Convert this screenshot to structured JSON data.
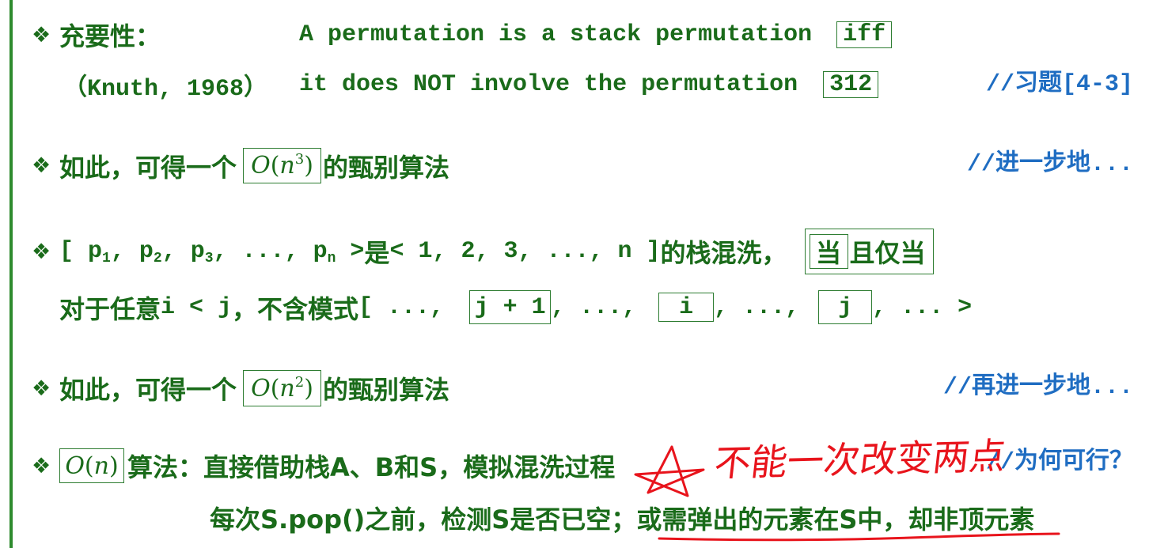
{
  "colors": {
    "text": "#1a6b1a",
    "comment": "#1f6dc2",
    "box_border": "#2e7d32",
    "left_rule": "#2e8b2e",
    "handwriting": "#e8141c"
  },
  "bullet": "❖",
  "line1": {
    "label": "充要性：",
    "text": "A permutation is a stack permutation",
    "box": "iff"
  },
  "line2": {
    "citation": "（Knuth, 1968）",
    "text": "it does NOT involve the permutation",
    "box": "312",
    "comment": "//习题[4-3]"
  },
  "line3": {
    "prefix": "如此，可得一个",
    "math": {
      "fn": "O",
      "open": "(",
      "var": "n",
      "exp": "3",
      "close": ")"
    },
    "suffix": "的甄别算法",
    "comment": "//进一步地..."
  },
  "line4": {
    "open": "[ ",
    "terms": [
      {
        "base": "p",
        "sub": "1"
      },
      {
        "base": "p",
        "sub": "2"
      },
      {
        "base": "p",
        "sub": "3"
      }
    ],
    "sep": ", ",
    "ellipsis": "...",
    "last": {
      "base": "p",
      "sub": "n"
    },
    "close": " >",
    "is": "是",
    "target": "< 1, 2, 3, ..., n ]",
    "suffix": "的栈混洗，",
    "box_inner": "当",
    "box_rest": "且仅当"
  },
  "line5": {
    "intro_a": "对于任意",
    "intro_b": "i < j",
    "intro_c": "，不含模式",
    "open": "[ ..., ",
    "box1": "j + 1",
    "sep1": ", ..., ",
    "box2": "i",
    "sep2": ", ..., ",
    "box3": "j",
    "close": ", ... >"
  },
  "line6": {
    "prefix": "如此，可得一个",
    "math": {
      "fn": "O",
      "open": "(",
      "var": "n",
      "exp": "2",
      "close": ")"
    },
    "suffix": "的甄别算法",
    "comment": "//再进一步地..."
  },
  "line7": {
    "math": {
      "fn": "O",
      "open": "(",
      "var": "n",
      "close": ")"
    },
    "text": "算法：直接借助栈A、B和S，模拟混洗过程",
    "annotation": "不能一次改变两点",
    "comment": "//为何可行？"
  },
  "line8": {
    "part1": "每次S.pop()之前，检测S是否已空；",
    "part2": "或需弹出的元素在S中，却非顶元素"
  }
}
